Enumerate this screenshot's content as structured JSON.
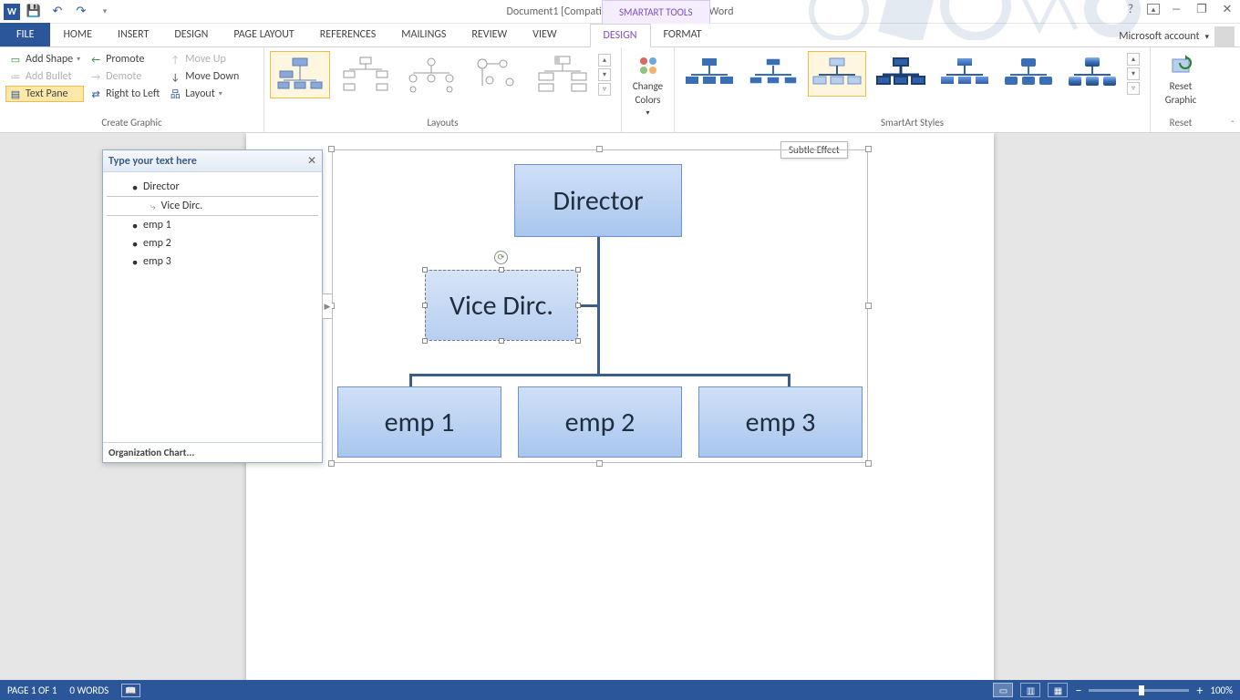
{
  "titlebar": {
    "title": "Document1 [Compatibility Mode] - Microsoft Word",
    "tooltab": "SMARTART TOOLS",
    "account": "Microsoft account"
  },
  "tabs": {
    "file": "FILE",
    "items": [
      "HOME",
      "INSERT",
      "DESIGN",
      "PAGE LAYOUT",
      "REFERENCES",
      "MAILINGS",
      "REVIEW",
      "VIEW"
    ],
    "tool_items": [
      "DESIGN",
      "FORMAT"
    ],
    "active_tool": "DESIGN"
  },
  "ribbon": {
    "create_graphic": {
      "label": "Create Graphic",
      "add_shape": "Add Shape",
      "add_bullet": "Add Bullet",
      "text_pane": "Text Pane",
      "promote": "Promote",
      "demote": "Demote",
      "right_to_left": "Right to Left",
      "move_up": "Move Up",
      "move_down": "Move Down",
      "layout": "Layout"
    },
    "layouts": {
      "label": "Layouts"
    },
    "change_colors": {
      "label": "Change",
      "label2": "Colors"
    },
    "styles": {
      "label": "SmartArt Styles"
    },
    "reset": {
      "label": "Reset",
      "btn": "Reset",
      "btn2": "Graphic"
    }
  },
  "tooltip": {
    "style_hover": "Subtle Effect"
  },
  "textpane": {
    "header": "Type your text here",
    "footer": "Organization Chart...",
    "items": [
      {
        "level": 1,
        "text": "Director"
      },
      {
        "level": 2,
        "text": "Vice Dirc.",
        "selected": true
      },
      {
        "level": 1,
        "text": "emp 1"
      },
      {
        "level": 1,
        "text": "emp 2"
      },
      {
        "level": 1,
        "text": "emp 3"
      }
    ]
  },
  "smartart": {
    "director": "Director",
    "vice": "Vice Dirc.",
    "emp1": "emp 1",
    "emp2": "emp 2",
    "emp3": "emp 3"
  },
  "status": {
    "page": "PAGE 1 OF 1",
    "words": "0 WORDS",
    "zoom": "100%"
  },
  "chart_data": {
    "type": "org-chart",
    "title": "Organization Chart",
    "nodes": [
      {
        "id": "director",
        "label": "Director",
        "parent": null
      },
      {
        "id": "vice",
        "label": "Vice Dirc.",
        "parent": "director",
        "assistant": true,
        "selected": true
      },
      {
        "id": "emp1",
        "label": "emp 1",
        "parent": "director"
      },
      {
        "id": "emp2",
        "label": "emp 2",
        "parent": "director"
      },
      {
        "id": "emp3",
        "label": "emp 3",
        "parent": "director"
      }
    ]
  }
}
